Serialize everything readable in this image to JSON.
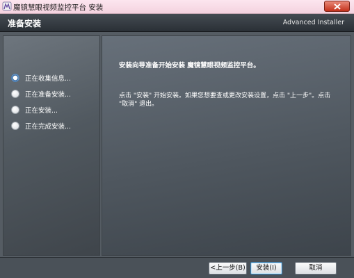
{
  "window": {
    "title": "魔镜慧眼视频监控平台 安装"
  },
  "header": {
    "title": "准备安装",
    "brand": "Advanced Installer"
  },
  "sidebar": {
    "steps": [
      {
        "label": "正在收集信息...",
        "state": "active"
      },
      {
        "label": "正在准备安装...",
        "state": "inactive"
      },
      {
        "label": "正在安装...",
        "state": "inactive"
      },
      {
        "label": "正在完成安装...",
        "state": "inactive"
      }
    ]
  },
  "content": {
    "heading": "安装向导准备开始安装 魔镜慧眼视频监控平台。",
    "description": "点击 \"安装\" 开始安装。如果您想要查或更改安装设置，点击 \"上一步\"。点击 \"取消\" 退出。"
  },
  "footer": {
    "back_label": "<上一步(B)",
    "install_label": "安装(I)",
    "cancel_label": "取消"
  },
  "colors": {
    "header_bg": "#2f353b",
    "panel_bg": "#555c63",
    "active_dot": "#3a6ea5"
  }
}
